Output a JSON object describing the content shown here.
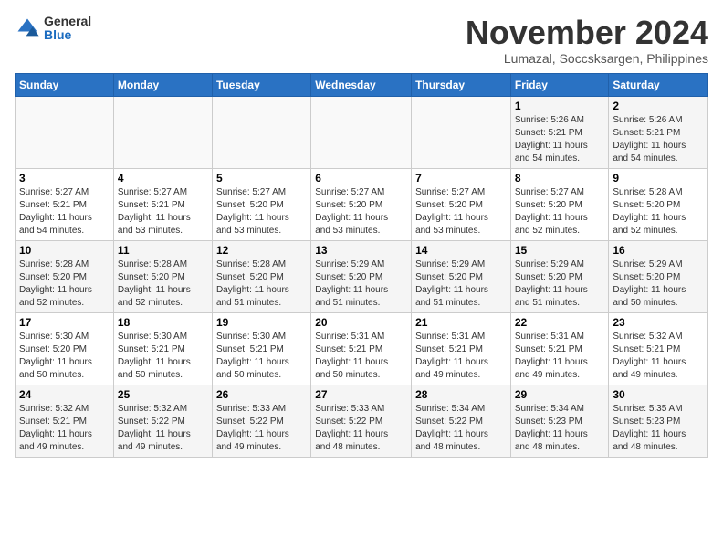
{
  "header": {
    "logo_general": "General",
    "logo_blue": "Blue",
    "month": "November 2024",
    "location": "Lumazal, Soccsksargen, Philippines"
  },
  "weekdays": [
    "Sunday",
    "Monday",
    "Tuesday",
    "Wednesday",
    "Thursday",
    "Friday",
    "Saturday"
  ],
  "weeks": [
    [
      {
        "day": "",
        "info": ""
      },
      {
        "day": "",
        "info": ""
      },
      {
        "day": "",
        "info": ""
      },
      {
        "day": "",
        "info": ""
      },
      {
        "day": "",
        "info": ""
      },
      {
        "day": "1",
        "info": "Sunrise: 5:26 AM\nSunset: 5:21 PM\nDaylight: 11 hours\nand 54 minutes."
      },
      {
        "day": "2",
        "info": "Sunrise: 5:26 AM\nSunset: 5:21 PM\nDaylight: 11 hours\nand 54 minutes."
      }
    ],
    [
      {
        "day": "3",
        "info": "Sunrise: 5:27 AM\nSunset: 5:21 PM\nDaylight: 11 hours\nand 54 minutes."
      },
      {
        "day": "4",
        "info": "Sunrise: 5:27 AM\nSunset: 5:21 PM\nDaylight: 11 hours\nand 53 minutes."
      },
      {
        "day": "5",
        "info": "Sunrise: 5:27 AM\nSunset: 5:20 PM\nDaylight: 11 hours\nand 53 minutes."
      },
      {
        "day": "6",
        "info": "Sunrise: 5:27 AM\nSunset: 5:20 PM\nDaylight: 11 hours\nand 53 minutes."
      },
      {
        "day": "7",
        "info": "Sunrise: 5:27 AM\nSunset: 5:20 PM\nDaylight: 11 hours\nand 53 minutes."
      },
      {
        "day": "8",
        "info": "Sunrise: 5:27 AM\nSunset: 5:20 PM\nDaylight: 11 hours\nand 52 minutes."
      },
      {
        "day": "9",
        "info": "Sunrise: 5:28 AM\nSunset: 5:20 PM\nDaylight: 11 hours\nand 52 minutes."
      }
    ],
    [
      {
        "day": "10",
        "info": "Sunrise: 5:28 AM\nSunset: 5:20 PM\nDaylight: 11 hours\nand 52 minutes."
      },
      {
        "day": "11",
        "info": "Sunrise: 5:28 AM\nSunset: 5:20 PM\nDaylight: 11 hours\nand 52 minutes."
      },
      {
        "day": "12",
        "info": "Sunrise: 5:28 AM\nSunset: 5:20 PM\nDaylight: 11 hours\nand 51 minutes."
      },
      {
        "day": "13",
        "info": "Sunrise: 5:29 AM\nSunset: 5:20 PM\nDaylight: 11 hours\nand 51 minutes."
      },
      {
        "day": "14",
        "info": "Sunrise: 5:29 AM\nSunset: 5:20 PM\nDaylight: 11 hours\nand 51 minutes."
      },
      {
        "day": "15",
        "info": "Sunrise: 5:29 AM\nSunset: 5:20 PM\nDaylight: 11 hours\nand 51 minutes."
      },
      {
        "day": "16",
        "info": "Sunrise: 5:29 AM\nSunset: 5:20 PM\nDaylight: 11 hours\nand 50 minutes."
      }
    ],
    [
      {
        "day": "17",
        "info": "Sunrise: 5:30 AM\nSunset: 5:20 PM\nDaylight: 11 hours\nand 50 minutes."
      },
      {
        "day": "18",
        "info": "Sunrise: 5:30 AM\nSunset: 5:21 PM\nDaylight: 11 hours\nand 50 minutes."
      },
      {
        "day": "19",
        "info": "Sunrise: 5:30 AM\nSunset: 5:21 PM\nDaylight: 11 hours\nand 50 minutes."
      },
      {
        "day": "20",
        "info": "Sunrise: 5:31 AM\nSunset: 5:21 PM\nDaylight: 11 hours\nand 50 minutes."
      },
      {
        "day": "21",
        "info": "Sunrise: 5:31 AM\nSunset: 5:21 PM\nDaylight: 11 hours\nand 49 minutes."
      },
      {
        "day": "22",
        "info": "Sunrise: 5:31 AM\nSunset: 5:21 PM\nDaylight: 11 hours\nand 49 minutes."
      },
      {
        "day": "23",
        "info": "Sunrise: 5:32 AM\nSunset: 5:21 PM\nDaylight: 11 hours\nand 49 minutes."
      }
    ],
    [
      {
        "day": "24",
        "info": "Sunrise: 5:32 AM\nSunset: 5:21 PM\nDaylight: 11 hours\nand 49 minutes."
      },
      {
        "day": "25",
        "info": "Sunrise: 5:32 AM\nSunset: 5:22 PM\nDaylight: 11 hours\nand 49 minutes."
      },
      {
        "day": "26",
        "info": "Sunrise: 5:33 AM\nSunset: 5:22 PM\nDaylight: 11 hours\nand 49 minutes."
      },
      {
        "day": "27",
        "info": "Sunrise: 5:33 AM\nSunset: 5:22 PM\nDaylight: 11 hours\nand 48 minutes."
      },
      {
        "day": "28",
        "info": "Sunrise: 5:34 AM\nSunset: 5:22 PM\nDaylight: 11 hours\nand 48 minutes."
      },
      {
        "day": "29",
        "info": "Sunrise: 5:34 AM\nSunset: 5:23 PM\nDaylight: 11 hours\nand 48 minutes."
      },
      {
        "day": "30",
        "info": "Sunrise: 5:35 AM\nSunset: 5:23 PM\nDaylight: 11 hours\nand 48 minutes."
      }
    ]
  ]
}
